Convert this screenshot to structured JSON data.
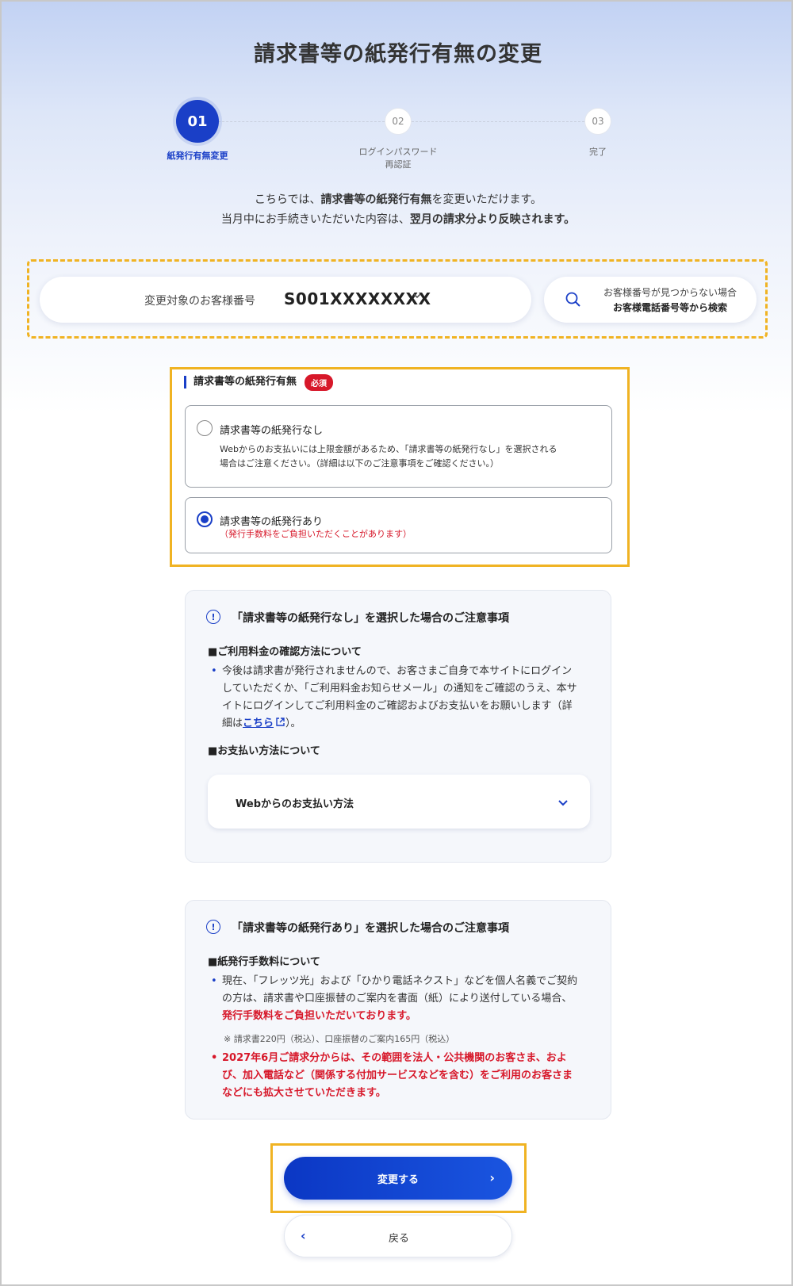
{
  "page": {
    "title": "請求書等の紙発行有無の変更"
  },
  "stepper": {
    "steps": [
      {
        "number": "01",
        "label": "紙発行有無変更",
        "state": "active"
      },
      {
        "number": "02",
        "label_line1": "ログインパスワード",
        "label_line2": "再認証",
        "state": "inactive"
      },
      {
        "number": "03",
        "label": "完了",
        "state": "inactive"
      }
    ]
  },
  "intro": {
    "line1_pre": "こちらでは、",
    "line1_bold": "請求書等の紙発行有無",
    "line1_post": "を変更いただけます。",
    "line2_pre": "当月中にお手続きいただいた内容は、",
    "line2_bold": "翌月の請求分より反映されます。"
  },
  "customer": {
    "label": "変更対象のお客様番号",
    "value": "S001XXXXXXXX",
    "chevron_icon": "chevron-down-icon"
  },
  "search": {
    "icon": "search-icon",
    "line1": "お客様番号が見つからない場合",
    "line2": "お客様電話番号等から検索"
  },
  "paper_option": {
    "section_label": "請求書等の紙発行有無",
    "required_badge": "必須",
    "options": [
      {
        "title": "請求書等の紙発行なし",
        "desc_line1": "Webからのお支払いには上限金額があるため、「請求書等の紙発行なし」を選択される",
        "desc_line2": "場合はご注意ください。（詳細は以下のご注意事項をご確認ください。）",
        "checked": false
      },
      {
        "title": "請求書等の紙発行あり",
        "fee_note": "（発行手数料をご負担いただくことがあります）",
        "checked": true
      }
    ]
  },
  "notice_no_paper": {
    "icon": "info-icon",
    "title": "「請求書等の紙発行なし」を選択した場合のご注意事項",
    "sub1": "■ご利用料金の確認方法について",
    "bullet_text_pre": "今後は請求書が発行されませんので、お客さまご自身で本サイトにログインしていただくか、「ご利用料金お知らせメール」の通知をご確認のうえ、本サイトにログインしてご利用料金のご確認およびお支払いをお願いします（詳細は",
    "bullet_link": "こちら",
    "bullet_text_post": "）。",
    "sub2": "■お支払い方法について",
    "accordion_label": "Webからのお支払い方法"
  },
  "notice_paper": {
    "icon": "info-icon",
    "title": "「請求書等の紙発行あり」を選択した場合のご注意事項",
    "sub1": "■紙発行手数料について",
    "bullet1_pre": "現在、「フレッツ光」および「ひかり電話ネクスト」などを個人名義でご契約の方は、請求書や口座振替のご案内を書面（紙）により送付している場合、",
    "bullet1_red": "発行手数料をご負担いただいております。",
    "note": "※ 請求書220円（税込）、口座振替のご案内165円（税込）",
    "bullet2": "2027年6月ご請求分からは、その範囲を法人・公共機関のお客さま、および、加入電話など（関係する付加サービスなどを含む）をご利用のお客さまなどにも拡大させていただきます。"
  },
  "actions": {
    "submit": "変更する",
    "back": "戻る"
  },
  "colors": {
    "accent": "#1a3fc7",
    "highlight": "#f0b323",
    "danger": "#d7182a"
  }
}
